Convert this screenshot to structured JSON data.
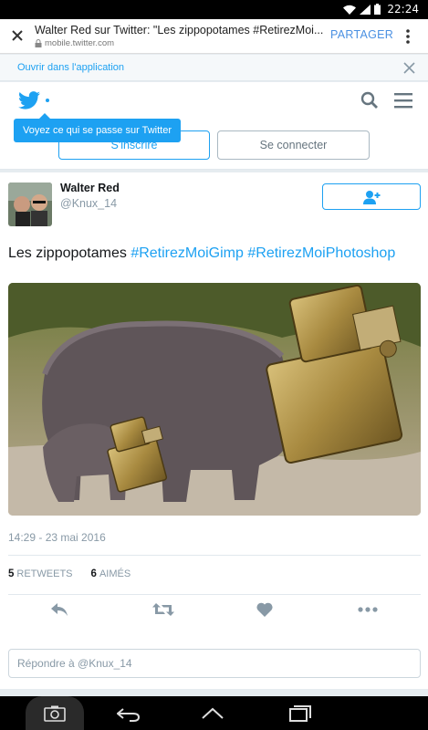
{
  "status_bar": {
    "time": "22:24",
    "icons": [
      "wifi-icon",
      "signal-icon",
      "battery-icon"
    ]
  },
  "browser": {
    "page_title": "Walter Red sur Twitter: \"Les zippopotames #RetirezMoi...",
    "url": "mobile.twitter.com",
    "share_label": "PARTAGER"
  },
  "open_app": {
    "label": "Ouvrir dans l'application"
  },
  "header": {
    "tooltip": "Voyez ce qui se passe sur Twitter",
    "signup_label": "S'inscrire",
    "login_label": "Se connecter"
  },
  "tweet": {
    "display_name": "Walter Red",
    "handle": "@Knux_14",
    "text_plain": "Les zippopotames ",
    "hashtag1": "#RetirezMoiGimp",
    "hashtag2": "#RetirezMoiPhotoshop",
    "timestamp": "14:29 - 23 mai 2016",
    "retweets_count": "5",
    "retweets_label": "RETWEETS",
    "likes_count": "6",
    "likes_label": "AIMÉS",
    "reply_placeholder": "Répondre à @Knux_14"
  },
  "colors": {
    "accent": "#1da1f2",
    "muted": "#8899a6",
    "background": "#e6ecf0"
  }
}
